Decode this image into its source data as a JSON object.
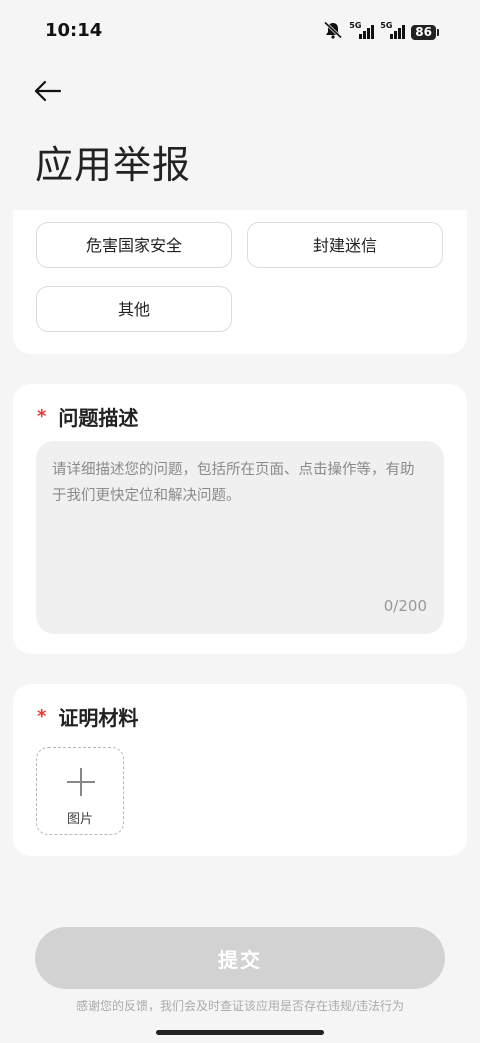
{
  "status_bar": {
    "time": "10:14",
    "network_1": "5G",
    "network_2": "5G",
    "battery": "86"
  },
  "header": {
    "title": "应用举报"
  },
  "categories": {
    "chips": [
      {
        "label": "危害国家安全"
      },
      {
        "label": "封建迷信"
      },
      {
        "label": "其他"
      }
    ]
  },
  "description": {
    "required_mark": "*",
    "title": "问题描述",
    "placeholder": "请详细描述您的问题，包括所在页面、点击操作等，有助于我们更快定位和解决问题。",
    "value": "",
    "counter": "0/200"
  },
  "proof": {
    "required_mark": "*",
    "title": "证明材料",
    "upload_label": "图片"
  },
  "submit": {
    "label": "提交"
  },
  "footer": {
    "note": "感谢您的反馈，我们会及时查证该应用是否存在违规/违法行为"
  },
  "colors": {
    "required": "#e53935",
    "submit_disabled": "#d2d2d2",
    "background": "#f5f5f5"
  }
}
